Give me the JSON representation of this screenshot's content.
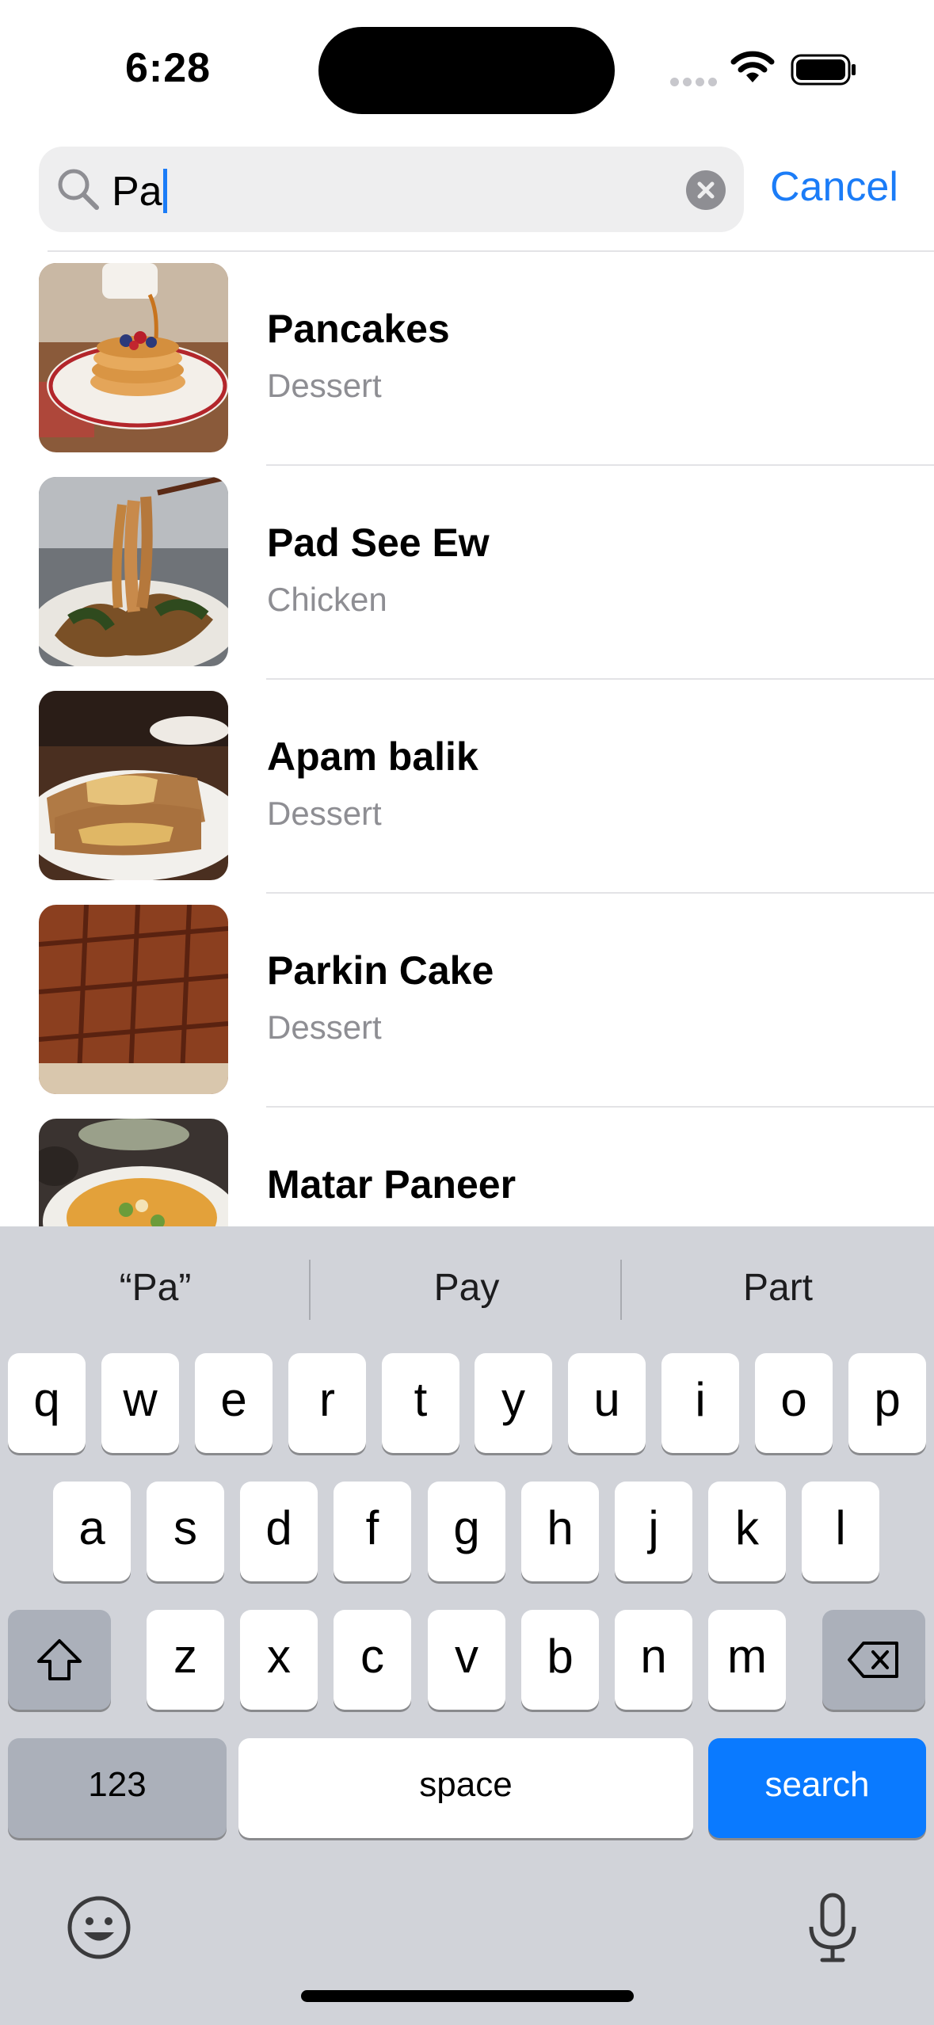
{
  "status_bar": {
    "time": "6:28"
  },
  "search": {
    "query": "Pa",
    "cancel_label": "Cancel"
  },
  "results": [
    {
      "title": "Pancakes",
      "category": "Dessert"
    },
    {
      "title": "Pad See Ew",
      "category": "Chicken"
    },
    {
      "title": "Apam balik",
      "category": "Dessert"
    },
    {
      "title": "Parkin Cake",
      "category": "Dessert"
    },
    {
      "title": "Matar Paneer",
      "category": ""
    }
  ],
  "keyboard": {
    "suggestions": [
      "“Pa”",
      "Pay",
      "Part"
    ],
    "row1": [
      "q",
      "w",
      "e",
      "r",
      "t",
      "y",
      "u",
      "i",
      "o",
      "p"
    ],
    "row2": [
      "a",
      "s",
      "d",
      "f",
      "g",
      "h",
      "j",
      "k",
      "l"
    ],
    "row3": [
      "z",
      "x",
      "c",
      "v",
      "b",
      "n",
      "m"
    ],
    "numbers_label": "123",
    "space_label": "space",
    "search_label": "search"
  },
  "colors": {
    "accent": "#1b7cf7",
    "keyboard_bg": "#d1d3d9",
    "search_key": "#0a7aff"
  },
  "icons": [
    "search-icon",
    "clear-icon",
    "shift-icon",
    "backspace-icon",
    "emoji-icon",
    "microphone-icon",
    "wifi-icon",
    "battery-icon"
  ]
}
